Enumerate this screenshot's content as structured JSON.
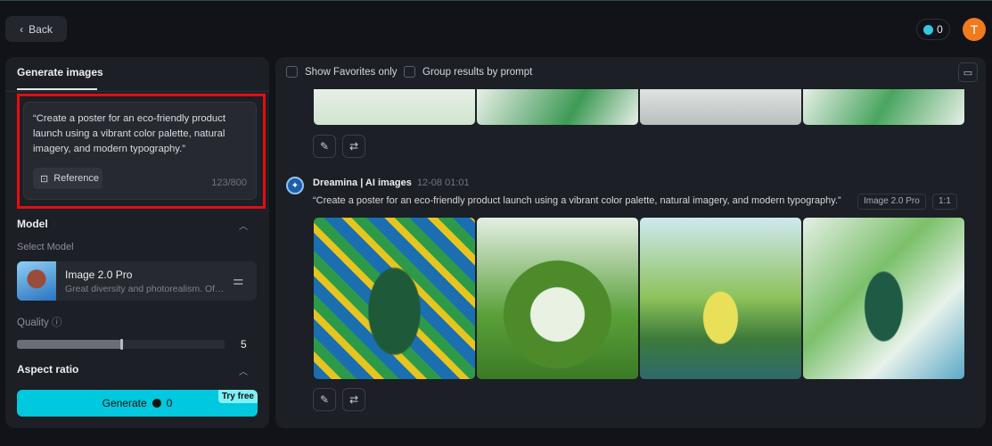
{
  "header": {
    "back_label": "Back",
    "credits": "0",
    "avatar_initial": "T"
  },
  "left": {
    "tab": "Generate images",
    "prompt": "“Create a poster for an eco-friendly product launch using a vibrant color palette, natural imagery, and modern typography.”",
    "reference_label": "Reference",
    "char_count": "123/800",
    "model_section": "Model",
    "select_model_label": "Select Model",
    "model_name": "Image 2.0 Pro",
    "model_desc": "Great diversity and photorealism. Offers...",
    "quality_label": "Quality",
    "quality_value": "5",
    "quality_fraction": 0.5,
    "aspect_section": "Aspect ratio",
    "generate_label": "Generate",
    "generate_cost": "0",
    "try_free": "Try free"
  },
  "main": {
    "show_favorites": "Show Favorites only",
    "group_by_prompt": "Group results by prompt",
    "result": {
      "author": "Dreamina | AI images",
      "time": "12-08  01:01",
      "prompt": "“Create a poster for an eco-friendly product launch using a vibrant color palette, natural imagery, and modern typography.”",
      "model_tag": "Image 2.0 Pro",
      "ratio_tag": "1:1"
    }
  },
  "colors": {
    "accent": "#00c8de",
    "highlight": "#e01010",
    "avatar": "#f07a1c"
  }
}
